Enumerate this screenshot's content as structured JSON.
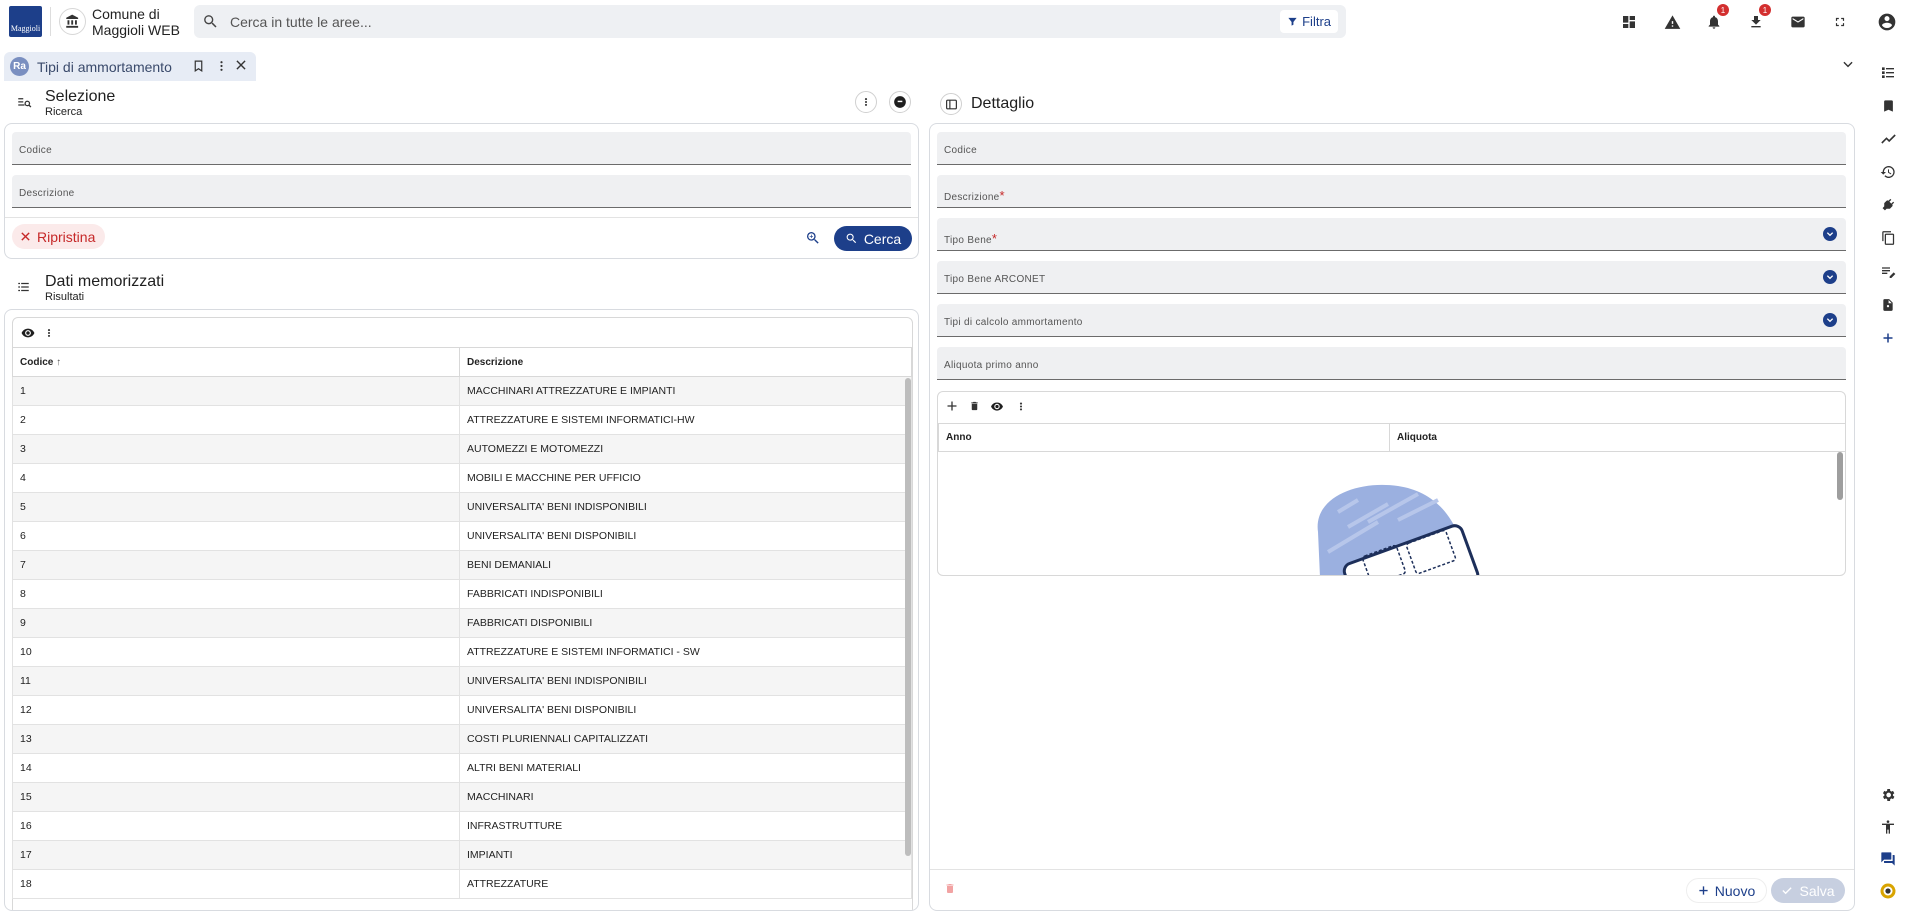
{
  "header": {
    "logo_text": "Maggioli",
    "org_line1": "Comune di",
    "org_line2": "Maggioli WEB",
    "search_placeholder": "Cerca in tutte le aree...",
    "filter_label": "Filtra",
    "notifications_count": "1",
    "downloads_count": "1"
  },
  "tab": {
    "icon_text": "Ra",
    "label": "Tipi di ammortamento"
  },
  "selezione": {
    "title": "Selezione",
    "subtitle": "Ricerca",
    "fields": {
      "codice": "Codice",
      "descrizione": "Descrizione"
    },
    "reset_label": "Ripristina",
    "search_label": "Cerca"
  },
  "risultati": {
    "title": "Dati memorizzati",
    "subtitle": "Risultati",
    "columns": [
      "Codice",
      "Descrizione"
    ],
    "rows": [
      [
        "1",
        "MACCHINARI ATTREZZATURE E IMPIANTI"
      ],
      [
        "2",
        "ATTREZZATURE E SISTEMI INFORMATICI-HW"
      ],
      [
        "3",
        "AUTOMEZZI E MOTOMEZZI"
      ],
      [
        "4",
        "MOBILI E MACCHINE PER UFFICIO"
      ],
      [
        "5",
        "UNIVERSALITA' BENI INDISPONIBILI"
      ],
      [
        "6",
        "UNIVERSALITA' BENI DISPONIBILI"
      ],
      [
        "7",
        "BENI DEMANIALI"
      ],
      [
        "8",
        "FABBRICATI INDISPONIBILI"
      ],
      [
        "9",
        "FABBRICATI DISPONIBILI"
      ],
      [
        "10",
        "ATTREZZATURE E SISTEMI INFORMATICI - SW"
      ],
      [
        "11",
        "UNIVERSALITA' BENI INDISPONIBILI"
      ],
      [
        "12",
        "UNIVERSALITA' BENI DISPONIBILI"
      ],
      [
        "13",
        "COSTI PLURIENNALI CAPITALIZZATI"
      ],
      [
        "14",
        "ALTRI BENI MATERIALI"
      ],
      [
        "15",
        "MACCHINARI"
      ],
      [
        "16",
        "INFRASTRUTTURE"
      ],
      [
        "17",
        "IMPIANTI"
      ],
      [
        "18",
        "ATTREZZATURE"
      ]
    ]
  },
  "dettaglio": {
    "title": "Dettaglio",
    "fields": {
      "codice": "Codice",
      "descrizione": "Descrizione",
      "tipo_bene": "Tipo Bene",
      "tipo_bene_arconet": "Tipo Bene ARCONET",
      "tipi_calcolo": "Tipi di calcolo ammortamento",
      "aliquota_primo_anno": "Aliquota primo anno"
    },
    "required_mark": "*",
    "grid_columns": [
      "Anno",
      "Aliquota"
    ],
    "nuovo_label": "Nuovo",
    "salva_label": "Salva"
  },
  "colors": {
    "brand": "#1d3f8a",
    "danger": "#c62828",
    "field_bg": "#eff0f2"
  }
}
